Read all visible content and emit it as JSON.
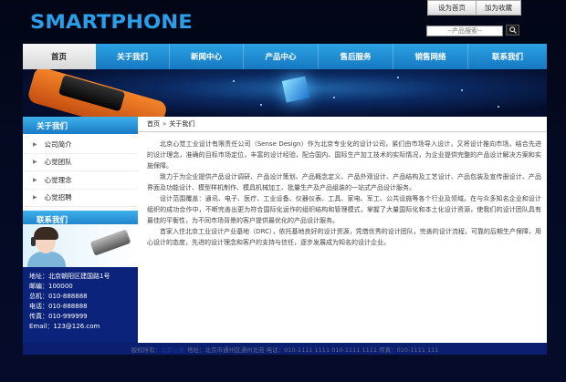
{
  "header": {
    "logo": "SMARTPHONE",
    "set_home": "设为首页",
    "add_favorite": "加为收藏",
    "search_placeholder": "--产品搜索--"
  },
  "nav": {
    "items": [
      "首页",
      "关于我们",
      "新闻中心",
      "产品中心",
      "售后服务",
      "销售网络",
      "联系我们"
    ],
    "active": "首页"
  },
  "sidebar": {
    "about_title": "关于我们",
    "about_items": [
      "公司简介",
      "心觉团队",
      "心觉理念",
      "心觉招聘"
    ],
    "contact_title": "联系我们",
    "contact_lines": [
      "地址：北京朝阳区建国路1号",
      "邮编：100000",
      "总机：010-888888",
      "电话：010-888888",
      "传真：010-999999",
      "Email：123@126.com"
    ]
  },
  "main": {
    "breadcrumb_home": "首页",
    "breadcrumb_sep": "»",
    "breadcrumb_current": "关于我们",
    "paragraphs": [
      "北京心觉工业设计有限责任公司（Sense Design）作为北京专业化的设计公司，紧们由市场导入设计，又将设计推向市场，结合先进的设计理念，准确的目标市场定位，丰富的设计经验，配合国内、国际生产加工技术的实际情况，为企业提供完整的产品设计解决方案和实施保障。",
      "致力于为企业提供产品设计调研、产品设计策划、产品概念定义、产品外观设计、产品结构及工艺设计、产品包装及宣传册设计、产品界面及功能设计、模型样机制作、模具机械加工、批量生产及产品组装的一站式产品设计服务。",
      "设计范围覆盖：通讯、电子、医疗、工业设备、仪器仪表、工具、家电、军工、公共设施等各个行业及领域。在与众多知名企业和设计组织的成功合作中，不断完善出更为符合国际化运作的组织结构和管理模式，掌握了大量国际化和本土化设计资源，使我们的设计团队具有最佳的平衡性，为不同市场背景的客户提供最优化的产品设计服务。",
      "首家入住北京工业设计产业基地（DRC），依托基地良好的设计资源，凭借优秀的设计团队，完善的设计流程，可靠的后期生产保障，用心设计的态度，先进的设计理念和客户的支持与信任，逐步发展成为知名的设计企业。"
    ]
  },
  "footer": {
    "copyright_prefix": "版权所有：",
    "company": "北京心觉",
    "address": "地址：北京市通州区通州北苑  电话：010-1111 1111  010-1111 1111  传真：010-1111 111"
  },
  "colors": {
    "nav_blue": "#1f8fd6",
    "logo_blue": "#2a9ee6",
    "contact_bg": "#0b237a",
    "page_bg": "#040a22"
  },
  "icons": [
    "search-icon",
    "arrow-right-icon",
    "phone-banner-image",
    "cube-banner-image",
    "customer-service-image"
  ]
}
